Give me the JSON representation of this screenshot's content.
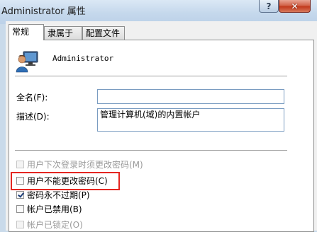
{
  "window": {
    "title": "Administrator 属性",
    "help_label": "?",
    "close_label": "✕"
  },
  "tabs": [
    {
      "label": "常规",
      "active": true
    },
    {
      "label": "隶属于",
      "active": false
    },
    {
      "label": "配置文件",
      "active": false
    }
  ],
  "general": {
    "user_icon": "user-icon",
    "username": "Administrator",
    "fullname": {
      "label": "全名(F):",
      "value": ""
    },
    "description": {
      "label": "描述(D):",
      "value": "管理计算机(域)的内置帐户"
    }
  },
  "options": [
    {
      "label": "用户下次登录时须更改密码(M)",
      "checked": false,
      "disabled": true
    },
    {
      "label": "用户不能更改密码(C)",
      "checked": false,
      "disabled": false,
      "highlighted": true
    },
    {
      "label": "密码永不过期(P)",
      "checked": true,
      "disabled": false
    },
    {
      "label": "帐户已禁用(B)",
      "checked": false,
      "disabled": false
    },
    {
      "label": "帐户已锁定(O)",
      "checked": false,
      "disabled": true
    }
  ],
  "colors": {
    "highlight": "#e42621",
    "titlebar": "#c5d8ec"
  }
}
